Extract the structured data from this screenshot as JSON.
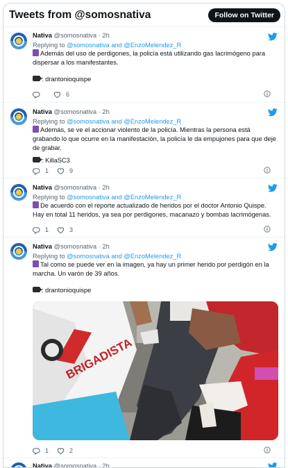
{
  "header": {
    "title": "Tweets from @somosnativa",
    "follow_label": "Follow on Twitter"
  },
  "tweets": [
    {
      "name": "Nativa",
      "handle": "@somosnativa",
      "time": "2h",
      "replying_prefix": "Replying to ",
      "replying_users": "@somosnativa and @EnzoMelendez_R",
      "text": "Además del uso de perdigones, la policía está utilizando gas lacrimógeno para dispersar a los manifestantes.",
      "credit": ": drantonioquispe",
      "reply_count": "",
      "like_count": "6"
    },
    {
      "name": "Nativa",
      "handle": "@somosnativa",
      "time": "2h",
      "replying_prefix": "Replying to ",
      "replying_users": "@somosnativa and @EnzoMelendez_R",
      "text": "Además, se ve el accionar violento de la policía. Mientras la persona está grabando lo que ocurre en la manifestación, la policía le da empujones para que deje de grabar.",
      "credit": ": KillaSC3",
      "reply_count": "1",
      "like_count": "9"
    },
    {
      "name": "Nativa",
      "handle": "@somosnativa",
      "time": "2h",
      "replying_prefix": "Replying to ",
      "replying_users": "@somosnativa and @EnzoMelendez_R",
      "text": "De acuerdo con el reporte actualizado de heridos por el doctor Antonio Quispe. Hay en total 11 heridos, ya sea por perdigones, macanazo y bombas lacrimógenas.",
      "reply_count": "1",
      "like_count": "3"
    },
    {
      "name": "Nativa",
      "handle": "@somosnativa",
      "time": "2h",
      "replying_prefix": "Replying to ",
      "replying_users": "@somosnativa and @EnzoMelendez_R",
      "text": "Tal como se puede ver en la imagen, ya hay un primer herido por perdigón en la marcha. Un varón de 39 años.",
      "credit": ": drantonioquispe",
      "image_text": "BRIGADISTA",
      "reply_count": "1",
      "like_count": "2"
    },
    {
      "name": "Nativa",
      "handle": "@somosnativa",
      "time": "2h"
    }
  ],
  "colors": {
    "accent": "#1d9bf0",
    "text": "#0f1419",
    "muted": "#536471",
    "border": "#eff3f4"
  },
  "icons": [
    "twitter-bird-icon",
    "reply-icon",
    "like-icon",
    "info-icon",
    "camera-emoji-icon",
    "purple-square-emoji-icon"
  ]
}
